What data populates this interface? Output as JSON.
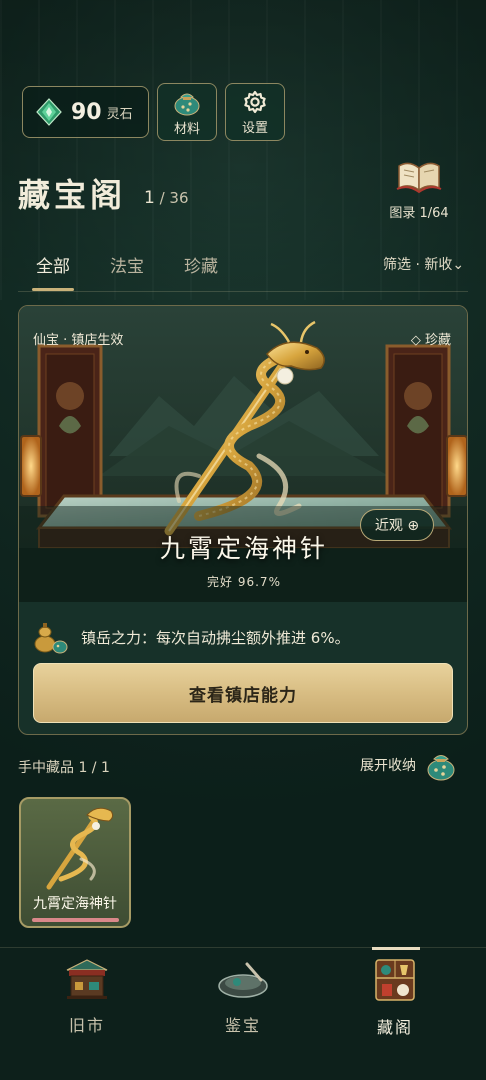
{
  "resources": {
    "stone_value": "90",
    "stone_unit": "灵石"
  },
  "top_buttons": {
    "materials_label": "材料",
    "settings_label": "设置"
  },
  "header": {
    "title": "藏宝阁",
    "count_current": "1",
    "count_total": "/ 36",
    "catalog_label": "图录 1/64"
  },
  "tabs": [
    {
      "label": "全部"
    },
    {
      "label": "法宝"
    },
    {
      "label": "珍藏"
    }
  ],
  "active_tab": "全部",
  "filter_label": "筛选 · 新收⌄",
  "featured": {
    "tag": "仙宝  ·  镇店生效",
    "rarity": "◇ 珍藏",
    "zoom_label": "近观 ⊕",
    "name": "九霄定海神针",
    "condition": "完好 96.7%",
    "ability": "镇岳之力：每次自动拂尘额外推进 6%。",
    "action_label": "查看镇店能力"
  },
  "inventory": {
    "label": "手中藏品 1 / 1",
    "expand_label": "展开收纳",
    "items": [
      {
        "name": "九霄定海神针"
      }
    ]
  },
  "bottom_nav": [
    {
      "label": "旧市"
    },
    {
      "label": "鉴宝"
    },
    {
      "label": "藏阁"
    }
  ],
  "colors": {
    "accent_gold": "#d8bd83",
    "background": "#122a23",
    "health_bar": "#d9888a"
  }
}
